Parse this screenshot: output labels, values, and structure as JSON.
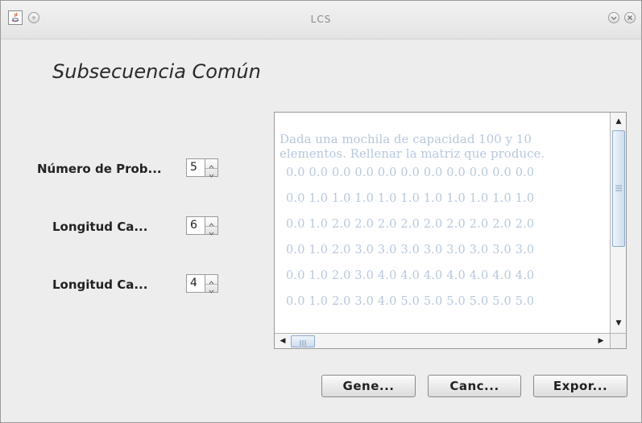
{
  "window": {
    "title": "LCS"
  },
  "heading": "Subsecuencia Común",
  "fields": [
    {
      "label": "Número de Prob...",
      "value": "5"
    },
    {
      "label": "Longitud Ca...",
      "value": "6"
    },
    {
      "label": "Longitud Ca...",
      "value": "4"
    }
  ],
  "output": {
    "line1": "Dada una mochila de capacidad 100 y 10",
    "line2": "elementos. Rellenar la matriz que produce.",
    "rows": [
      "0.0 0.0 0.0 0.0 0.0 0.0 0.0 0.0 0.0 0.0 0.0",
      "0.0 1.0 1.0 1.0 1.0 1.0 1.0 1.0 1.0 1.0 1.0",
      "0.0 1.0 2.0 2.0 2.0 2.0 2.0 2.0 2.0 2.0 2.0",
      "0.0 1.0 2.0 3.0 3.0 3.0 3.0 3.0 3.0 3.0 3.0",
      "0.0 1.0 2.0 3.0 4.0 4.0 4.0 4.0 4.0 4.0 4.0",
      "0.0 1.0 2.0 3.0 4.0 5.0 5.0 5.0 5.0 5.0 5.0"
    ]
  },
  "buttons": {
    "generate": "Gene...",
    "cancel": "Canc...",
    "export": "Expor..."
  }
}
